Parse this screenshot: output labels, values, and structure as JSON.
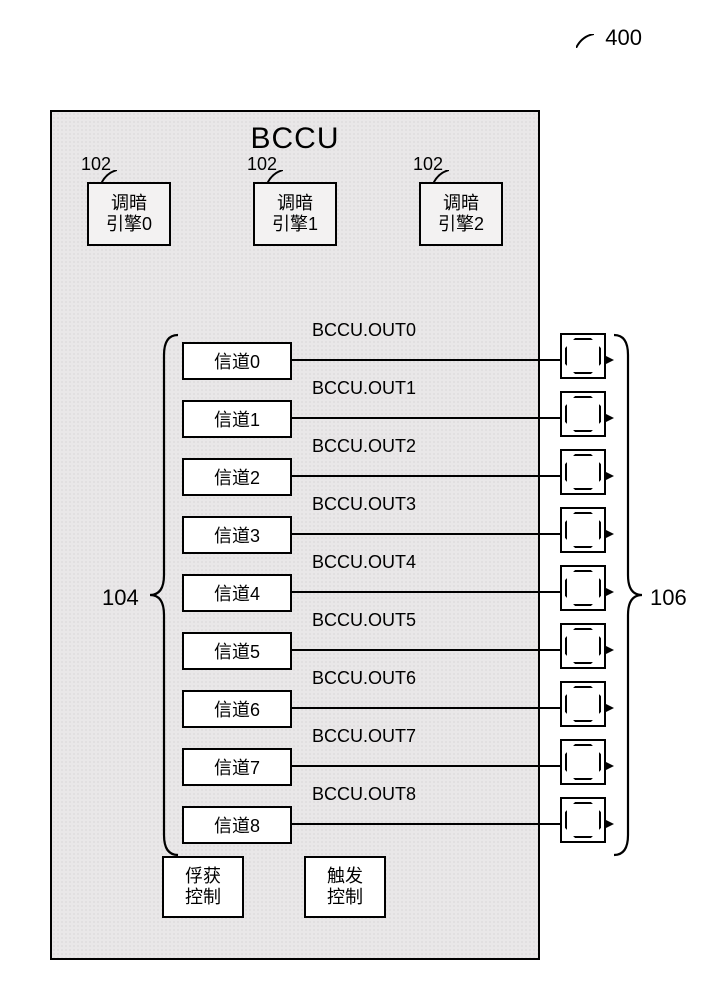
{
  "figure_ref": "400",
  "main_title": "BCCU",
  "ref_engines": "102",
  "ref_channels": "104",
  "ref_leds": "106",
  "engines": [
    {
      "label": "调暗\n引擎0"
    },
    {
      "label": "调暗\n引擎1"
    },
    {
      "label": "调暗\n引擎2"
    }
  ],
  "channels": [
    {
      "label": "信道0",
      "out": "BCCU.OUT0"
    },
    {
      "label": "信道1",
      "out": "BCCU.OUT1"
    },
    {
      "label": "信道2",
      "out": "BCCU.OUT2"
    },
    {
      "label": "信道3",
      "out": "BCCU.OUT3"
    },
    {
      "label": "信道4",
      "out": "BCCU.OUT4"
    },
    {
      "label": "信道5",
      "out": "BCCU.OUT5"
    },
    {
      "label": "信道6",
      "out": "BCCU.OUT6"
    },
    {
      "label": "信道7",
      "out": "BCCU.OUT7"
    },
    {
      "label": "信道8",
      "out": "BCCU.OUT8"
    }
  ],
  "controls": {
    "capture": "俘获\n控制",
    "trigger": "触发\n控制"
  }
}
